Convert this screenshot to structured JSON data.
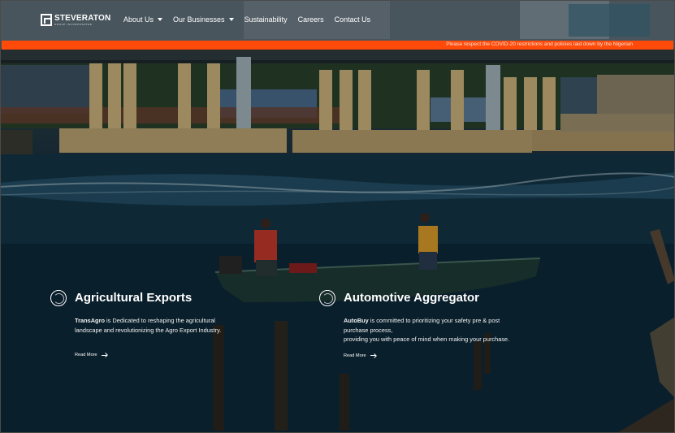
{
  "brand": {
    "name": "STEVERATON",
    "tagline": "GROUP INCORPORATED"
  },
  "nav": {
    "items": [
      {
        "label": "About Us",
        "has_dropdown": true
      },
      {
        "label": "Our Businesses",
        "has_dropdown": true
      },
      {
        "label": "Sustainability",
        "has_dropdown": false
      },
      {
        "label": "Careers",
        "has_dropdown": false
      },
      {
        "label": "Contact Us",
        "has_dropdown": false
      }
    ]
  },
  "announcement": {
    "text": "Please respect the COVID-20 restrictions and policies laid down by the Nigerian"
  },
  "cards": [
    {
      "title": "Agricultural Exports",
      "brand": "TransAgro",
      "text": " is Dedicated to reshaping the agricultural landscape and revolutionizing the Agro Export Industry.",
      "link": "Read More"
    },
    {
      "title": "Automotive Aggregator",
      "brand": "AutoBuy",
      "text_line1": " is committed to prioritizing your safety pre & post purchase process,",
      "text_line2": "providing you with peace of mind when making your purchase.",
      "link": "Read More"
    }
  ],
  "colors": {
    "accent": "#ff4a0a",
    "text": "#ffffff"
  }
}
